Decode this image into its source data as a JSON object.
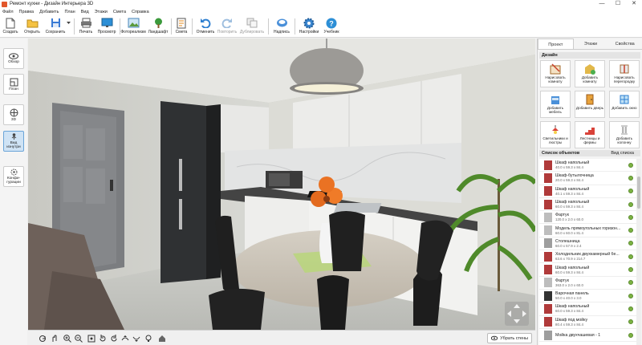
{
  "window": {
    "title": "Ремонт кухни - Дизайн Интерьера 3D",
    "minimize": "—",
    "maximize": "☐",
    "close": "✕"
  },
  "menu": [
    "Файл",
    "Правка",
    "Добавить",
    "План",
    "Вид",
    "Этажи",
    "Смета",
    "Справка"
  ],
  "toolbar": {
    "create": "Создать",
    "open": "Открыть",
    "save": "Сохранить",
    "print": "Печать",
    "preview": "Просмотр",
    "photo": "Фотореализм",
    "landscape": "Ландшафт",
    "estimate": "Смета",
    "undo": "Отменить",
    "redo": "Повторить",
    "duplicate": "Дублировать",
    "signature": "Надпись",
    "settings": "Настройки",
    "tutorial": "Учебник"
  },
  "left_panel": {
    "overview": "Обзор",
    "plan": "План",
    "threed": "3D",
    "interior": "Вид изнутри",
    "configurations": "Конфи- гурации"
  },
  "viewport": {
    "hide_walls": "Убрать стены"
  },
  "right_panel": {
    "tabs": [
      "Проект",
      "Этажи",
      "Свойства"
    ],
    "design_title": "Дизайн",
    "design_buttons": [
      "Нарисовать комнату",
      "Добавить комнату",
      "Нарисовать перегородку",
      "Добавить мебель",
      "Добавить дверь",
      "Добавить окно",
      "Светильники и люстры",
      "Лестницы и фермы",
      "Добавить колонну"
    ],
    "objects_title": "Список объектов",
    "objects_view": "Вид списка",
    "objects": [
      {
        "name": "Шкаф напольный",
        "dims": "40.0 x 59.3 x 84.4",
        "color": "#b03a3a"
      },
      {
        "name": "Шкаф-бутылочница",
        "dims": "20.0 x 59.3 x 84.4",
        "color": "#b03a3a"
      },
      {
        "name": "Шкаф напольный",
        "dims": "40.1 x 59.3 x 84.4",
        "color": "#b03a3a"
      },
      {
        "name": "Шкаф напольный",
        "dims": "60.0 x 59.3 x 84.4",
        "color": "#b03a3a"
      },
      {
        "name": "Фартук",
        "dims": "120.0 x 2.0 x 60.0",
        "color": "#bdbdbd"
      },
      {
        "name": "Модель прямоугольных горизон...",
        "dims": "60.0 x 60.0 x 81.4",
        "color": "#bdbdbd"
      },
      {
        "name": "Столешница",
        "dims": "60.0 x 57.9 x 2.4",
        "color": "#9e9e9e"
      },
      {
        "name": "Холодильник двухкамерный бе...",
        "dims": "63.6 x 70.9 x 214.7",
        "color": "#b03a3a"
      },
      {
        "name": "Шкаф напольный",
        "dims": "60.0 x 59.3 x 84.4",
        "color": "#b03a3a"
      },
      {
        "name": "Фартук",
        "dims": "363.0 x 2.0 x 60.0",
        "color": "#bdbdbd"
      },
      {
        "name": "Варочная панель",
        "dims": "50.0 x 40.0 x 3.0",
        "color": "#333333"
      },
      {
        "name": "Шкаф напольный",
        "dims": "60.0 x 59.3 x 84.4",
        "color": "#b03a3a"
      },
      {
        "name": "Шкаф под мойку",
        "dims": "80.4 x 59.3 x 84.4",
        "color": "#b03a3a"
      },
      {
        "name": "Мойка двухчашевая - 1",
        "dims": "",
        "color": "#9e9e9e"
      }
    ]
  }
}
